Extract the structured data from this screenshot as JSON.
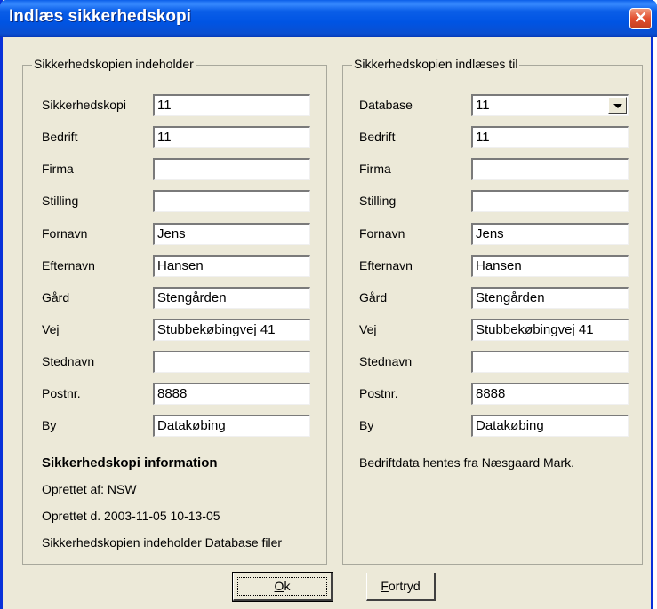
{
  "window": {
    "title": "Indlæs sikkerhedskopi",
    "close_glyph": "✕"
  },
  "left": {
    "title": "Sikkerhedskopien indeholder",
    "rows": [
      {
        "label": "Sikkerhedskopi",
        "value": "11"
      },
      {
        "label": "Bedrift",
        "value": "11"
      },
      {
        "label": "Firma",
        "value": ""
      },
      {
        "label": "Stilling",
        "value": ""
      },
      {
        "label": "Fornavn",
        "value": "Jens"
      },
      {
        "label": "Efternavn",
        "value": "Hansen"
      },
      {
        "label": "Gård",
        "value": "Stengården"
      },
      {
        "label": "Vej",
        "value": "Stubbekøbingvej 41"
      },
      {
        "label": "Stednavn",
        "value": ""
      },
      {
        "label": "Postnr.",
        "value": "8888"
      },
      {
        "label": "By",
        "value": "Datakøbing"
      }
    ],
    "info_heading": "Sikkerhedskopi information",
    "info_lines": [
      "Oprettet af: NSW",
      "Oprettet d. 2003-11-05 10-13-05",
      "Sikkerhedskopien indeholder Database filer"
    ]
  },
  "right": {
    "title": "Sikkerhedskopien indlæses til",
    "rows": [
      {
        "label": "Database",
        "value": "11"
      },
      {
        "label": "Bedrift",
        "value": "11"
      },
      {
        "label": "Firma",
        "value": ""
      },
      {
        "label": "Stilling",
        "value": ""
      },
      {
        "label": "Fornavn",
        "value": "Jens"
      },
      {
        "label": "Efternavn",
        "value": "Hansen"
      },
      {
        "label": "Gård",
        "value": "Stengården"
      },
      {
        "label": "Vej",
        "value": "Stubbekøbingvej 41"
      },
      {
        "label": "Stednavn",
        "value": ""
      },
      {
        "label": "Postnr.",
        "value": "8888"
      },
      {
        "label": "By",
        "value": "Datakøbing"
      }
    ],
    "note": "Bedriftdata hentes fra Næsgaard Mark."
  },
  "buttons": {
    "ok": {
      "mnemonic": "O",
      "rest": "k"
    },
    "cancel": {
      "mnemonic": "F",
      "rest": "ortryd"
    }
  }
}
